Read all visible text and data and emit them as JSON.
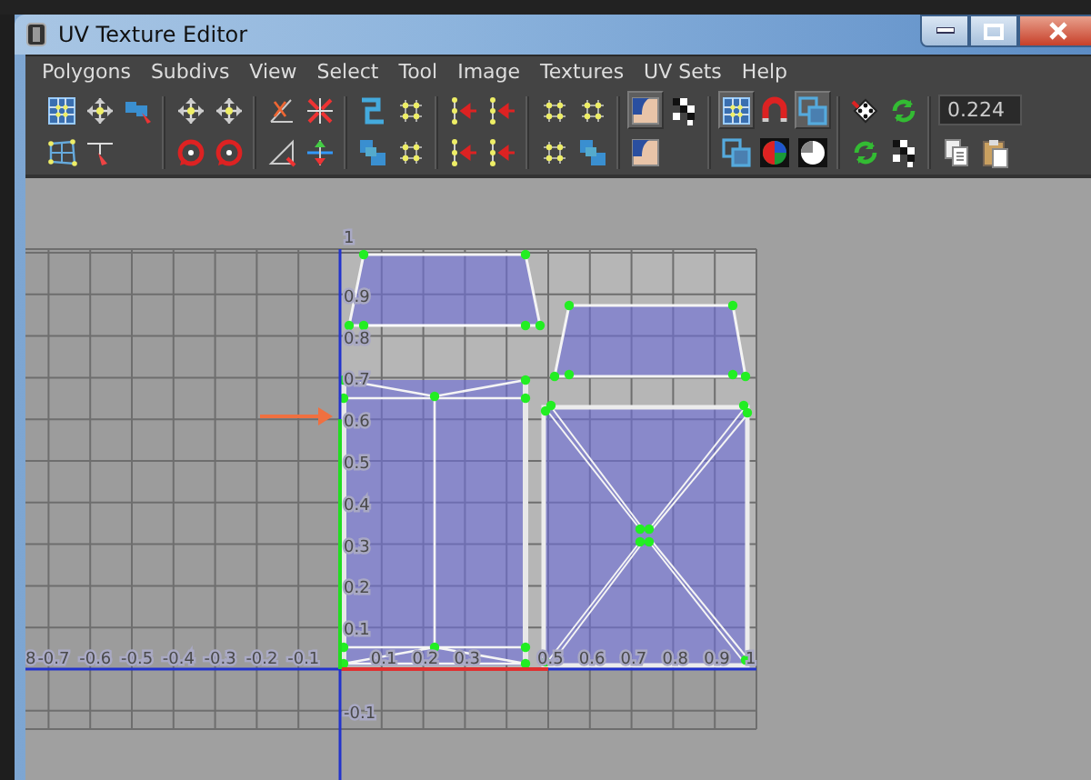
{
  "window": {
    "title": "UV Texture Editor"
  },
  "window_controls": [
    {
      "kind": "minimize"
    },
    {
      "kind": "maximize"
    },
    {
      "kind": "close"
    }
  ],
  "menu": [
    "Polygons",
    "Subdivs",
    "View",
    "Select",
    "Tool",
    "Image",
    "Textures",
    "UV Sets",
    "Help"
  ],
  "toolbar": {
    "groups": [
      {
        "rows": [
          [
            {
              "kind": "grid",
              "pressed": false
            },
            {
              "kind": "move",
              "pressed": false
            },
            {
              "kind": "shell",
              "pressed": false
            }
          ],
          [
            {
              "kind": "lattice",
              "pressed": false
            },
            {
              "kind": "smudge",
              "pressed": false
            }
          ]
        ]
      },
      {
        "rows": [
          [
            {
              "kind": "move",
              "pressed": false
            },
            {
              "kind": "move",
              "pressed": false
            }
          ],
          [
            {
              "kind": "rotate",
              "pressed": false
            },
            {
              "kind": "rotate",
              "pressed": false
            }
          ]
        ]
      },
      {
        "rows": [
          [
            {
              "kind": "cut",
              "pressed": false
            },
            {
              "kind": "sew",
              "pressed": false
            }
          ],
          [
            {
              "kind": "triangle",
              "pressed": false
            },
            {
              "kind": "flip",
              "pressed": false
            }
          ]
        ]
      },
      {
        "rows": [
          [
            {
              "kind": "unfold",
              "pressed": false
            },
            {
              "kind": "dots",
              "pressed": false
            }
          ],
          [
            {
              "kind": "layout",
              "pressed": false
            },
            {
              "kind": "dots",
              "pressed": false
            }
          ]
        ]
      },
      {
        "rows": [
          [
            {
              "kind": "align",
              "pressed": false
            },
            {
              "kind": "align",
              "pressed": false
            }
          ],
          [
            {
              "kind": "align",
              "pressed": false
            },
            {
              "kind": "align",
              "pressed": false
            }
          ]
        ]
      },
      {
        "rows": [
          [
            {
              "kind": "dots",
              "pressed": false
            },
            {
              "kind": "dots",
              "pressed": false
            }
          ],
          [
            {
              "kind": "dots",
              "pressed": false
            },
            {
              "kind": "layout",
              "pressed": false
            }
          ]
        ]
      },
      {
        "rows": [
          [
            {
              "kind": "image",
              "pressed": true
            },
            {
              "kind": "checker",
              "pressed": false
            }
          ],
          [
            {
              "kind": "image",
              "pressed": false
            }
          ]
        ]
      },
      {
        "rows": [
          [
            {
              "kind": "grid",
              "pressed": true
            },
            {
              "kind": "magnet",
              "pressed": false
            },
            {
              "kind": "overlap",
              "pressed": true
            }
          ],
          [
            {
              "kind": "overlap",
              "pressed": false
            },
            {
              "kind": "rgb",
              "pressed": false
            },
            {
              "kind": "halftone",
              "pressed": false
            }
          ]
        ]
      },
      {
        "rows": [
          [
            {
              "kind": "dice",
              "pressed": false
            },
            {
              "kind": "cycle",
              "pressed": false
            }
          ],
          [
            {
              "kind": "cycle",
              "pressed": false
            },
            {
              "kind": "checker",
              "pressed": false
            }
          ]
        ]
      },
      {
        "rows": [
          [
            {
              "kind": "field",
              "value": "0.224"
            }
          ],
          [
            {
              "kind": "copy",
              "pressed": false
            },
            {
              "kind": "paste",
              "pressed": false
            }
          ]
        ]
      }
    ]
  },
  "uv_grid": {
    "u_labels": [
      "8",
      "-0.7",
      "-0.6",
      "-0.5",
      "-0.4",
      "-0.3",
      "-0.2",
      "-0.1",
      "0.1",
      "0.2",
      "0.3",
      "0.5",
      "0.6",
      "0.7",
      "0.8",
      "0.9",
      "1"
    ],
    "v_labels": [
      "1",
      "0.9",
      "0.8",
      "0.7",
      "0.6",
      "0.5",
      "0.4",
      "0.3",
      "0.2",
      "0.1",
      "-0.1"
    ]
  }
}
